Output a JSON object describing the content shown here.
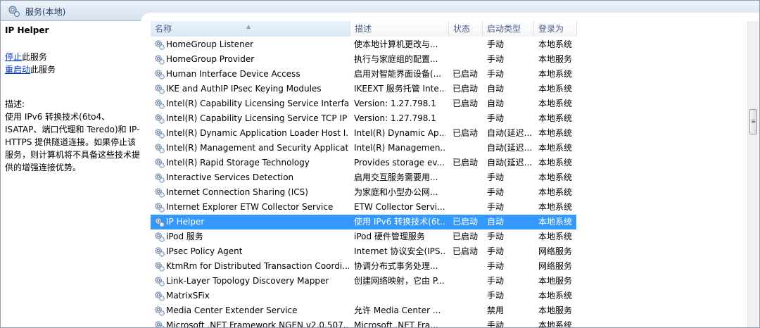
{
  "header": {
    "title": "服务(本地)",
    "icon": "services-icon"
  },
  "left_panel": {
    "service_title": "IP Helper",
    "stop_link": "停止",
    "stop_suffix": "此服务",
    "restart_link": "重启动",
    "restart_suffix": "此服务",
    "desc_label": "描述:",
    "description": "使用 IPv6 转换技术(6to4、ISATAP、端口代理和 Teredo)和 IP-HTTPS 提供隧道连接。如果停止该服务，则计算机将不具备这些技术提供的增强连接优势。"
  },
  "columns": {
    "name": "名称",
    "desc": "描述",
    "status": "状态",
    "start_type": "启动类型",
    "logon": "登录为"
  },
  "rows": [
    {
      "name": "HomeGroup Listener",
      "desc": "使本地计算机更改与...",
      "status": "",
      "start_type": "手动",
      "logon": "本地系统"
    },
    {
      "name": "HomeGroup Provider",
      "desc": "执行与家庭组的配置...",
      "status": "",
      "start_type": "手动",
      "logon": "本地服务"
    },
    {
      "name": "Human Interface Device Access",
      "desc": "启用对智能界面设备(...",
      "status": "已启动",
      "start_type": "手动",
      "logon": "本地系统"
    },
    {
      "name": "IKE and AuthIP IPsec Keying Modules",
      "desc": "IKEEXT 服务托管 Inte...",
      "status": "已启动",
      "start_type": "自动",
      "logon": "本地系统"
    },
    {
      "name": "Intel(R) Capability Licensing Service Interface",
      "desc": "Version: 1.27.798.1",
      "status": "已启动",
      "start_type": "自动",
      "logon": "本地系统"
    },
    {
      "name": "Intel(R) Capability Licensing Service TCP IP ...",
      "desc": "Version: 1.27.798.1",
      "status": "",
      "start_type": "手动",
      "logon": "本地系统"
    },
    {
      "name": "Intel(R) Dynamic Application Loader Host I...",
      "desc": "Intel(R) Dynamic Ap...",
      "status": "已启动",
      "start_type": "自动(延迟...",
      "logon": "本地系统"
    },
    {
      "name": "Intel(R) Management and Security Applicat...",
      "desc": "Intel(R) Managemen...",
      "status": "",
      "start_type": "自动(延迟...",
      "logon": "本地系统"
    },
    {
      "name": "Intel(R) Rapid Storage Technology",
      "desc": "Provides storage ev...",
      "status": "已启动",
      "start_type": "自动(延迟...",
      "logon": "本地系统"
    },
    {
      "name": "Interactive Services Detection",
      "desc": "启用交互服务需要用...",
      "status": "",
      "start_type": "手动",
      "logon": "本地系统"
    },
    {
      "name": "Internet Connection Sharing (ICS)",
      "desc": "为家庭和小型办公网...",
      "status": "",
      "start_type": "手动",
      "logon": "本地系统"
    },
    {
      "name": "Internet Explorer ETW Collector Service",
      "desc": "ETW Collector Servi...",
      "status": "",
      "start_type": "手动",
      "logon": "本地系统"
    },
    {
      "name": "IP Helper",
      "desc": "使用 IPv6 转换技术(6t...",
      "status": "已启动",
      "start_type": "自动",
      "logon": "本地系统",
      "selected": true
    },
    {
      "name": "iPod 服务",
      "desc": "iPod 硬件管理服务",
      "status": "已启动",
      "start_type": "手动",
      "logon": "本地系统"
    },
    {
      "name": "IPsec Policy Agent",
      "desc": "Internet 协议安全(IPS...",
      "status": "已启动",
      "start_type": "手动",
      "logon": "网络服务"
    },
    {
      "name": "KtmRm for Distributed Transaction Coordi...",
      "desc": "协调分布式事务处理...",
      "status": "",
      "start_type": "手动",
      "logon": "网络服务"
    },
    {
      "name": "Link-Layer Topology Discovery Mapper",
      "desc": "创建网络映射，它由 P...",
      "status": "",
      "start_type": "手动",
      "logon": "本地服务"
    },
    {
      "name": "MatrixSFix",
      "desc": "",
      "status": "",
      "start_type": "手动",
      "logon": "本地系统"
    },
    {
      "name": "Media Center Extender Service",
      "desc": "允许 Media Center ...",
      "status": "",
      "start_type": "禁用",
      "logon": "本地服务"
    },
    {
      "name": "Microsoft .NET Framework NGEN v2.0.507...",
      "desc": "Microsoft .NET Fra...",
      "status": "",
      "start_type": "手动",
      "logon": "本地系统"
    }
  ],
  "colors": {
    "selected_bg": "#3399ff",
    "link": "#0033cc",
    "header_text": "#4d6185"
  }
}
